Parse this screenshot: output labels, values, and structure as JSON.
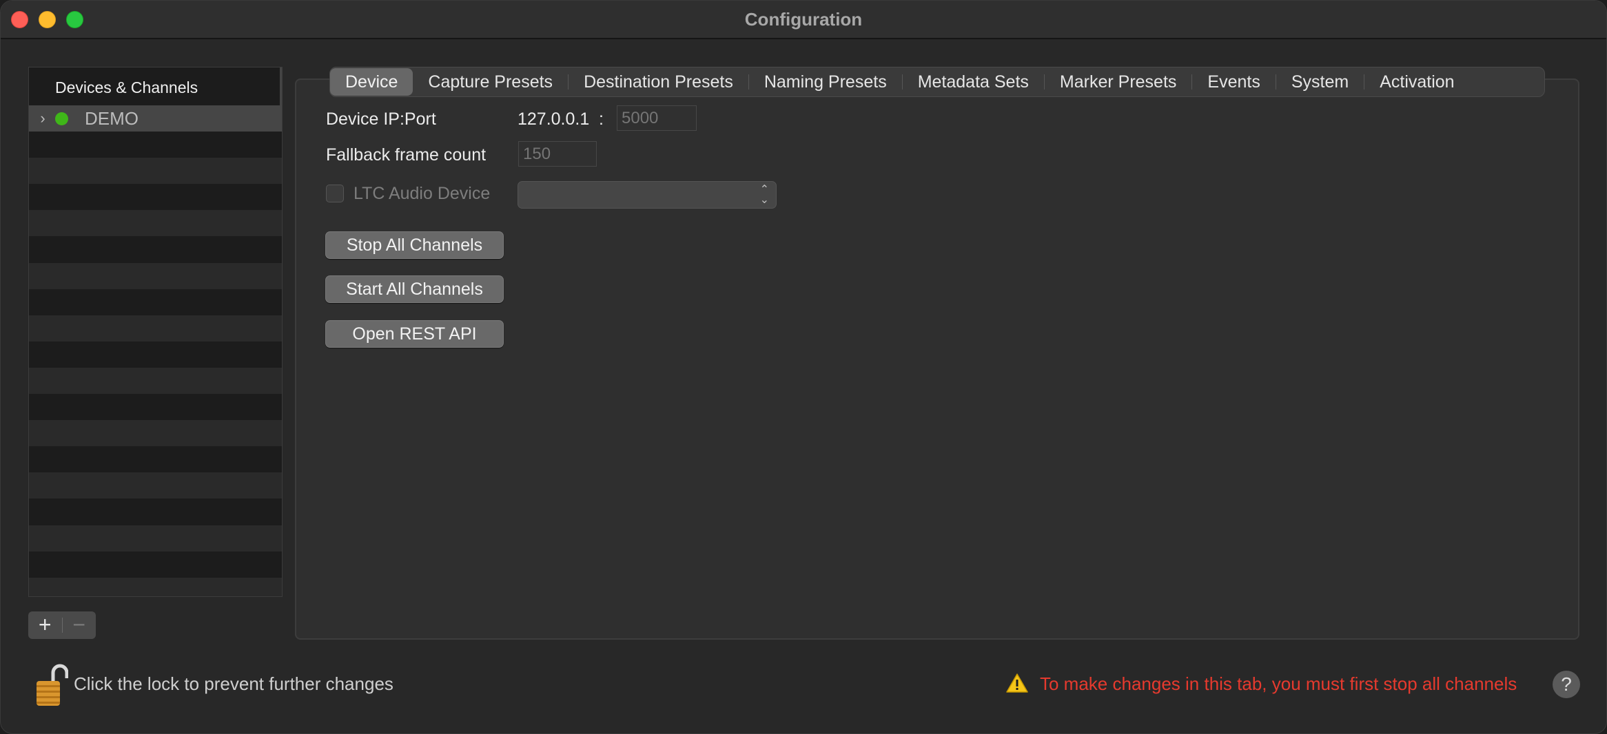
{
  "window": {
    "title": "Configuration"
  },
  "sidebar": {
    "header": "Devices & Channels",
    "devices": [
      {
        "name": "DEMO",
        "status": "online",
        "status_color": "#3fb619",
        "expanded": false
      }
    ],
    "add_label": "+",
    "remove_label": "−"
  },
  "tabs": [
    {
      "label": "Device",
      "active": true
    },
    {
      "label": "Capture Presets",
      "active": false
    },
    {
      "label": "Destination Presets",
      "active": false
    },
    {
      "label": "Naming Presets",
      "active": false
    },
    {
      "label": "Metadata Sets",
      "active": false
    },
    {
      "label": "Marker Presets",
      "active": false
    },
    {
      "label": "Events",
      "active": false
    },
    {
      "label": "System",
      "active": false
    },
    {
      "label": "Activation",
      "active": false
    }
  ],
  "device": {
    "ip_port_label": "Device IP:Port",
    "ip_value": "127.0.0.1",
    "ip_port_separator": ":",
    "port_placeholder": "5000",
    "fallback_label": "Fallback frame count",
    "fallback_placeholder": "150",
    "ltc_label": "LTC Audio Device",
    "ltc_checked": false,
    "ltc_selected": "",
    "stop_all_label": "Stop All Channels",
    "start_all_label": "Start All Channels",
    "open_rest_label": "Open REST API"
  },
  "footer": {
    "lock_text": "Click the lock to prevent further changes",
    "warning_text": "To make changes in this tab, you must first stop all channels",
    "warning_color": "#e63a2e",
    "help_label": "?"
  },
  "icons": {
    "close": "close-icon",
    "minimize": "minimize-icon",
    "maximize": "maximize-icon",
    "lock": "lock-open-icon",
    "warning": "warning-icon",
    "help": "help-icon"
  }
}
